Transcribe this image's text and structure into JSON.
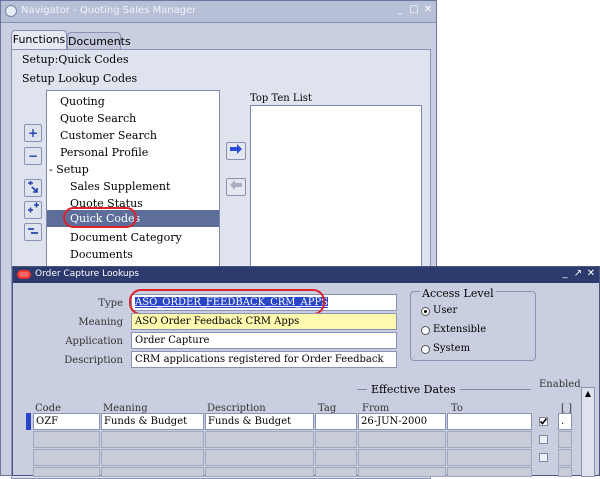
{
  "navigator": {
    "title": "Navigator - Quoting Sales Manager",
    "tabs": [
      {
        "label": "Functions",
        "active": true
      },
      {
        "label": "Documents",
        "active": false
      }
    ],
    "breadcrumbs": [
      "Setup:Quick Codes",
      "Setup Lookup Codes"
    ],
    "list_items": [
      {
        "label": "Quoting"
      },
      {
        "label": "Quote Search"
      },
      {
        "label": "Customer Search"
      },
      {
        "label": "Personal Profile"
      },
      {
        "label": "- Setup"
      },
      {
        "label": "Sales Supplement"
      },
      {
        "label": "Quote Status"
      },
      {
        "label": "Quick Codes",
        "selected": true
      },
      {
        "label": "Document Category"
      },
      {
        "label": "Documents"
      }
    ],
    "top_ten_label": "Top Ten List",
    "side_buttons": [
      "+",
      "−"
    ],
    "tree_buttons": [
      "expand-branch",
      "expand-all",
      "collapse-all"
    ]
  },
  "lookups": {
    "title": "Order Capture Lookups",
    "fields": {
      "type_label": "Type",
      "type_value": "ASO_ORDER_FEEDBACK_CRM_APPS",
      "meaning_label": "Meaning",
      "meaning_value": "ASO Order Feedback CRM Apps",
      "application_label": "Application",
      "application_value": "Order Capture",
      "description_label": "Description",
      "description_value": "CRM applications registered for Order Feedback"
    },
    "access_level": {
      "label": "Access Level",
      "options": [
        "User",
        "Extensible",
        "System"
      ],
      "selected": "User"
    },
    "table": {
      "effective_dates_label": "Effective Dates",
      "enabled_label": "Enabled",
      "headers": [
        "Code",
        "Meaning",
        "Description",
        "Tag",
        "From",
        "To"
      ],
      "extra_header": "[ ]",
      "rows": [
        {
          "code": "OZF",
          "meaning": "Funds & Budget",
          "description": "Funds & Budget",
          "tag": "",
          "from": "26-JUN-2000",
          "to": "",
          "enabled": true
        }
      ]
    }
  }
}
